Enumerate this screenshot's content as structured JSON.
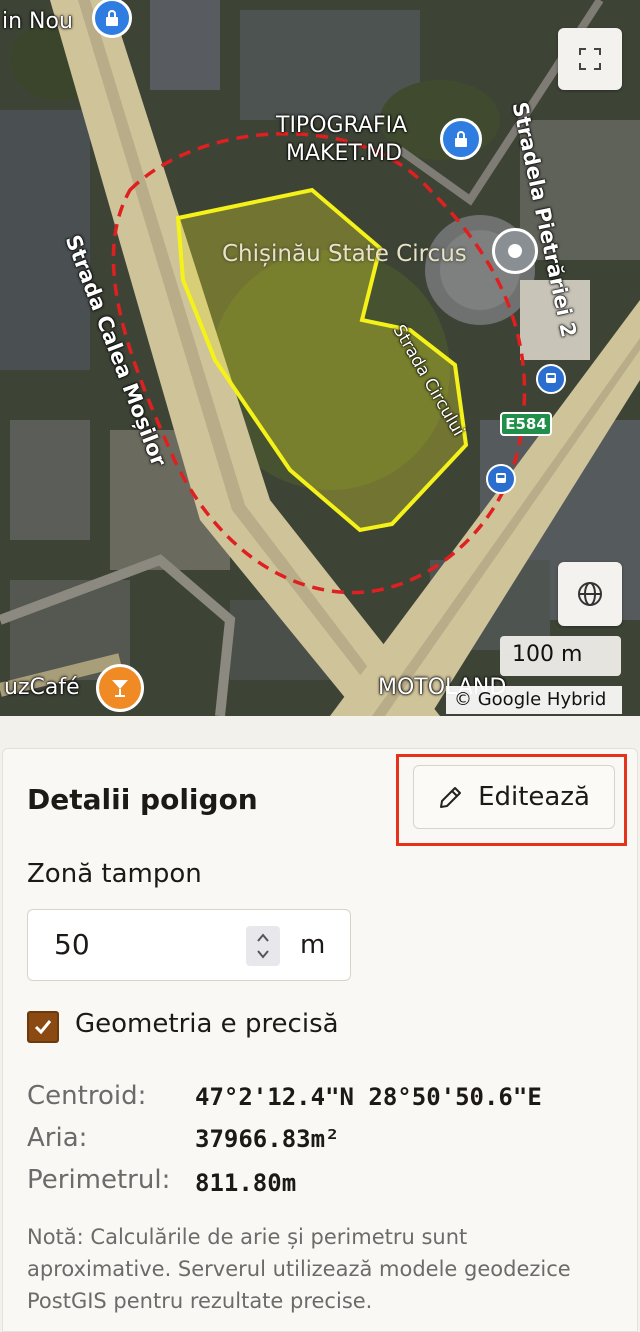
{
  "map": {
    "labels": {
      "top_left": "in Nou",
      "typography_line1": "TIPOGRAFIA",
      "typography_line2": "MAKET.MD",
      "circus": "Chișinău State Circus",
      "street_east": "Stradela Pietrăriei 2",
      "street_west": "Strada Calea Moșilor",
      "street_circului": "Strada Circului",
      "route": "E584",
      "cafe": "uzCafé",
      "bottom_right": "MOTOLAND"
    },
    "scale": "100 m",
    "attribution": "© Google Hybrid",
    "polygon_color": "#f5f21a",
    "buffer_color": "#e02020",
    "icons": [
      "fullscreen-icon",
      "globe-icon",
      "lock-pin-icon",
      "location-pin-icon",
      "bus-icon",
      "cocktail-icon"
    ]
  },
  "panel": {
    "title": "Detalii poligon",
    "edit_label": "Editează",
    "buffer_label": "Zonă tampon",
    "buffer_value": "50",
    "buffer_unit": "m",
    "precise_label": "Geometria e precisă",
    "precise_checked": true,
    "rows": [
      {
        "label": "Centroid:",
        "value": "47°2'12.4\"N 28°50'50.6\"E"
      },
      {
        "label": "Aria:",
        "value": "37966.83m²"
      },
      {
        "label": "Perimetrul:",
        "value": "811.80m"
      }
    ],
    "note": "Notă: Calculările de arie și perimetru sunt aproximative. Serverul utilizează modele geodezice PostGIS pentru rezultate precise.",
    "accent": "#8a4a12",
    "highlight_color": "#e4321b"
  }
}
